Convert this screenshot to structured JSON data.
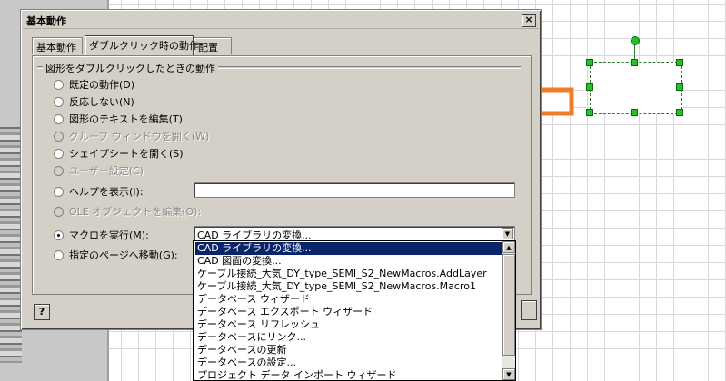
{
  "dialog": {
    "title": "基本動作",
    "close_glyph": "×",
    "tabs": [
      {
        "label": "基本動作"
      },
      {
        "label": "ダブルクリック時の動作"
      },
      {
        "label": "配置"
      }
    ],
    "group_label": "図形をダブルクリックしたときの動作",
    "options": [
      {
        "label": "既定の動作(D)"
      },
      {
        "label": "反応しない(N)"
      },
      {
        "label": "図形のテキストを編集(T)"
      },
      {
        "label": "グループ ウィンドウを開く(W)"
      },
      {
        "label": "シェイプシートを開く(S)"
      },
      {
        "label": "ユーザー設定(C)"
      },
      {
        "label": "ヘルプを表示(I):"
      },
      {
        "label": "OLE オブジェクトを編集(O):"
      },
      {
        "label": "マクロを実行(M):"
      },
      {
        "label": "指定のページへ移動(G):"
      }
    ],
    "help_input_value": "",
    "macro_selected": "CAD ライブラリの変換...",
    "help_button_glyph": "?"
  },
  "macro_list": [
    "CAD ライブラリの変換...",
    "CAD 図面の変換...",
    "ケーブル接続_大気_DY_type_SEMI_S2_NewMacros.AddLayer",
    "ケーブル接続_大気_DY_type_SEMI_S2_NewMacros.Macro1",
    "データベース ウィザード",
    "データベース エクスポート ウィザード",
    "データベース リフレッシュ",
    "データベースにリンク...",
    "データベースの更新",
    "データベースの設定...",
    "プロジェクト データ インポート ウィザード"
  ],
  "icons": {
    "dropdown": "chevron-down-icon",
    "scroll_up": "scroll-up-icon",
    "scroll_down": "scroll-down-icon",
    "arrow": "pointer-arrow"
  },
  "colors": {
    "arrow": "#f07c28",
    "selection": "#0a246a",
    "handle": "#22c322"
  }
}
